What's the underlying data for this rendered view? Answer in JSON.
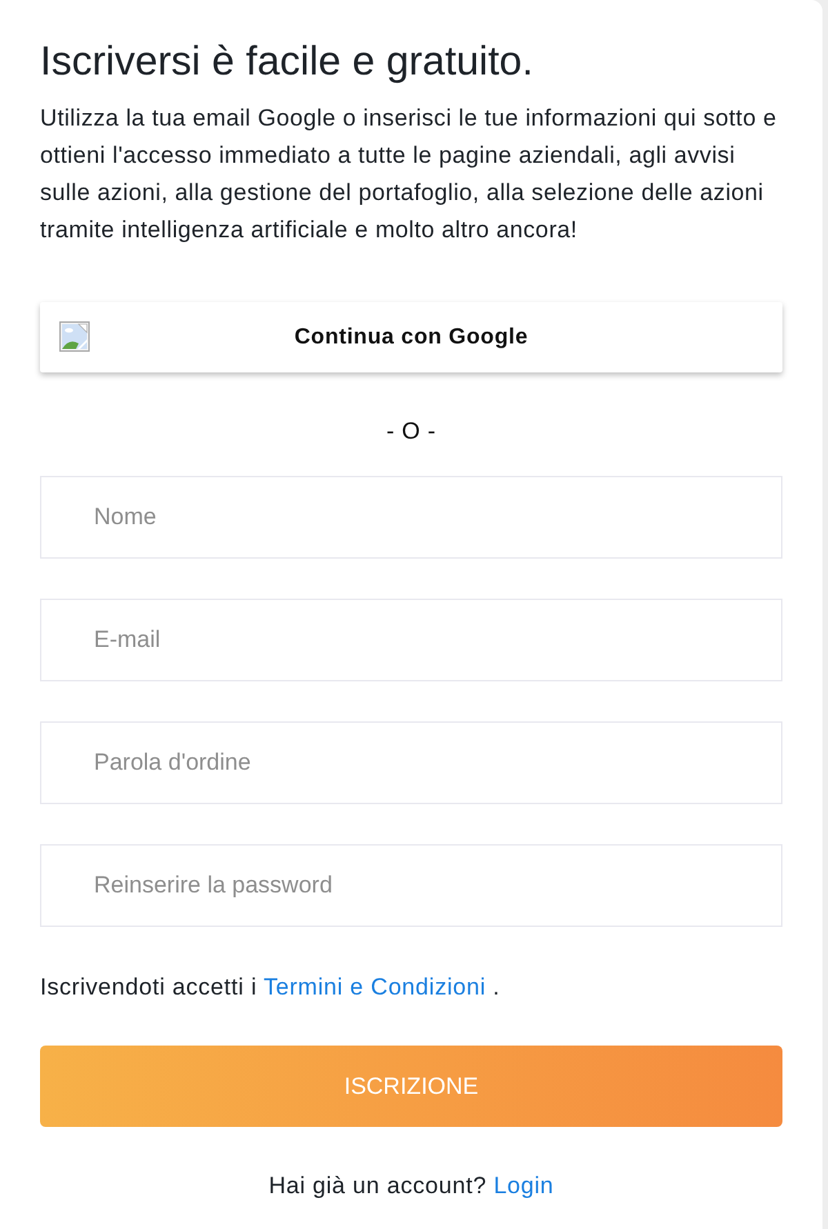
{
  "heading": "Iscriversi è facile e gratuito.",
  "intro": "Utilizza la tua email Google o inserisci le tue informazioni qui sotto e ottieni l'accesso immediato a tutte le pagine aziendali, agli avvisi sulle azioni, alla gestione del portafoglio, alla selezione delle azioni tramite intelligenza artificiale e molto altro ancora!",
  "google_button": {
    "label": "Continua con Google"
  },
  "divider": "- O -",
  "fields": [
    {
      "placeholder": "Nome"
    },
    {
      "placeholder": "E-mail"
    },
    {
      "placeholder": "Parola d'ordine"
    },
    {
      "placeholder": "Reinserire la password"
    }
  ],
  "terms": {
    "before": "Iscrivendoti accetti i",
    "link": "Termini e Condizioni",
    "after": "."
  },
  "submit_button": {
    "label": "ISCRIZIONE"
  },
  "login": {
    "text": "Hai già un account?",
    "link": "Login"
  }
}
